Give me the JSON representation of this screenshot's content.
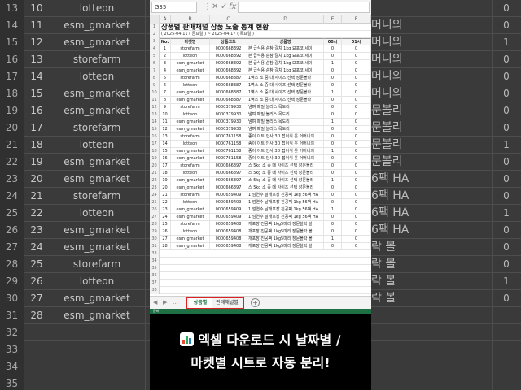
{
  "background": {
    "left_rows": [
      {
        "n": "13",
        "no": "10",
        "ch": "lotteon"
      },
      {
        "n": "14",
        "no": "11",
        "ch": "esm_gmarket"
      },
      {
        "n": "15",
        "no": "12",
        "ch": "esm_gmarket"
      },
      {
        "n": "16",
        "no": "13",
        "ch": "storefarm"
      },
      {
        "n": "17",
        "no": "14",
        "ch": "lotteon"
      },
      {
        "n": "18",
        "no": "15",
        "ch": "esm_gmarket"
      },
      {
        "n": "19",
        "no": "16",
        "ch": "esm_gmarket"
      },
      {
        "n": "20",
        "no": "17",
        "ch": "storefarm"
      },
      {
        "n": "21",
        "no": "18",
        "ch": "lotteon"
      },
      {
        "n": "22",
        "no": "19",
        "ch": "esm_gmarket"
      },
      {
        "n": "23",
        "no": "20",
        "ch": "esm_gmarket"
      },
      {
        "n": "24",
        "no": "21",
        "ch": "storefarm"
      },
      {
        "n": "25",
        "no": "22",
        "ch": "lotteon"
      },
      {
        "n": "26",
        "no": "23",
        "ch": "esm_gmarket"
      },
      {
        "n": "27",
        "no": "24",
        "ch": "esm_gmarket"
      },
      {
        "n": "28",
        "no": "25",
        "ch": "storefarm"
      },
      {
        "n": "29",
        "no": "26",
        "ch": "lotteon"
      },
      {
        "n": "30",
        "no": "27",
        "ch": "esm_gmarket"
      },
      {
        "n": "31",
        "no": "28",
        "ch": "esm_gmarket"
      },
      {
        "n": "32",
        "no": "",
        "ch": ""
      },
      {
        "n": "33",
        "no": "",
        "ch": ""
      },
      {
        "n": "34",
        "no": "",
        "ch": ""
      },
      {
        "n": "35",
        "no": "",
        "ch": ""
      }
    ],
    "right_rows": [
      {
        "t": "",
        "v": "0"
      },
      {
        "t": "머니의",
        "v": "0"
      },
      {
        "t": "머니의",
        "v": "1"
      },
      {
        "t": "머니의",
        "v": "0"
      },
      {
        "t": "머니의",
        "v": "0"
      },
      {
        "t": "머니의",
        "v": "0"
      },
      {
        "t": "문볼리",
        "v": "0"
      },
      {
        "t": "문볼리",
        "v": "0"
      },
      {
        "t": "문볼리",
        "v": "1"
      },
      {
        "t": "문볼리",
        "v": "0"
      },
      {
        "t": "6팩 HA",
        "v": "0"
      },
      {
        "t": "6팩 HA",
        "v": "0"
      },
      {
        "t": "6팩 HA",
        "v": "1"
      },
      {
        "t": "6팩 HA",
        "v": "0"
      },
      {
        "t": "락 볼",
        "v": "0"
      },
      {
        "t": "락 볼",
        "v": "0"
      },
      {
        "t": "락 볼",
        "v": "1"
      },
      {
        "t": "락 볼",
        "v": "0"
      }
    ]
  },
  "formula_bar": {
    "cell_ref": "G35",
    "cancel": "✕",
    "enter": "✓",
    "fx": "fx"
  },
  "columns": [
    "A",
    "B",
    "C",
    "D",
    "E",
    "F"
  ],
  "sheet": {
    "title": "상품별 판매채널 상품 노출 통계 현황",
    "subtitle": "( 2025-04-11 ( 금요일 ) ~ 2025-04-17 ( 목요일 ) )",
    "headers": [
      "No.",
      "마켓명",
      "상품코드",
      "상품명",
      "00시",
      "01시"
    ],
    "rows": [
      [
        "1",
        "storefarm",
        "0000668392",
        "본 급식용 순참 갈치 1kg 묘포코 세이",
        "0",
        "0"
      ],
      [
        "2",
        "lotteon",
        "0000668392",
        "본 급식용 순참 갈치 1kg 묘포코 세이",
        "0",
        "0"
      ],
      [
        "3",
        "esm_gmarket",
        "0000668392",
        "본 급식용 순참 갈치 1kg 묘포코 세이",
        "1",
        "0"
      ],
      [
        "4",
        "esm_gmarket",
        "0000668392",
        "본 급식용 순참 갈치 1kg 묘포코 세이",
        "0",
        "0"
      ],
      [
        "5",
        "storefarm",
        "0000668387",
        "1벽스 소 중 대 사이즈 선택 장문볼라",
        "0",
        "0"
      ],
      [
        "6",
        "lotteon",
        "0000668387",
        "1벽스 소 중 대 사이즈 선택 장문볼라",
        "0",
        "0"
      ],
      [
        "7",
        "esm_gmarket",
        "0000668387",
        "1벽스 소 중 대 사이즈 선택 장문볼라",
        "1",
        "0"
      ],
      [
        "8",
        "esm_gmarket",
        "0000668387",
        "1벽스 소 중 대 사이즈 선택 장문볼라",
        "0",
        "0"
      ],
      [
        "9",
        "storefarm",
        "0000379930",
        "냄며 패밀 볼리스 목도리",
        "0",
        "0"
      ],
      [
        "10",
        "lotteon",
        "0000379930",
        "냄며 패밀 볼리스 목도리",
        "0",
        "0"
      ],
      [
        "11",
        "esm_gmarket",
        "0000379930",
        "냄며 패밀 볼리스 목도리",
        "1",
        "0"
      ],
      [
        "12",
        "esm_gmarket",
        "0000379930",
        "냄며 패밀 볼리스 목도리",
        "0",
        "0"
      ],
      [
        "13",
        "storefarm",
        "0000761158",
        "종이 이트 인사 3D 접이식 옷 어머니의",
        "0",
        "0"
      ],
      [
        "14",
        "lotteon",
        "0000761158",
        "종이 이트 인사 3D 접이식 옷 어머니의",
        "0",
        "0"
      ],
      [
        "15",
        "esm_gmarket",
        "0000761158",
        "종이 이트 인사 3D 접이식 옷 어머니의",
        "1",
        "0"
      ],
      [
        "16",
        "esm_gmarket",
        "0000761158",
        "종이 이트 인사 3D 접이식 옷 어머니의",
        "0",
        "0"
      ],
      [
        "17",
        "storefarm",
        "0000666397",
        "스 5kg 소 중 대 사이즈 선택 장문볼라",
        "0",
        "0"
      ],
      [
        "18",
        "lotteon",
        "0000666397",
        "스 5kg 소 중 대 사이즈 선택 장문볼라",
        "0",
        "0"
      ],
      [
        "19",
        "esm_gmarket",
        "0000666397",
        "스 5kg 소 중 대 사이즈 선택 장문볼라",
        "1",
        "0"
      ],
      [
        "20",
        "esm_gmarket",
        "0000666397",
        "스 5kg 소 중 대 사이즈 선택 장문볼라",
        "0",
        "0"
      ],
      [
        "21",
        "storefarm",
        "0000659409",
        "1 엄연수 날개포장 진공팩 1kg 56팩 HA",
        "0",
        "0"
      ],
      [
        "22",
        "lotteon",
        "0000659409",
        "1 엄연수 날개포장 진공팩 1kg 56팩 HA",
        "0",
        "0"
      ],
      [
        "23",
        "esm_gmarket",
        "0000659409",
        "1 엄연수 날개포장 진공팩 1kg 56팩 HA",
        "1",
        "0"
      ],
      [
        "24",
        "esm_gmarket",
        "0000659409",
        "1 엄연수 날개포장 진공팩 1kg 56팩 HA",
        "0",
        "0"
      ],
      [
        "25",
        "storefarm",
        "0000659408",
        "개포장 진공팩 1kg5마리 장문볼락 볼",
        "0",
        "0"
      ],
      [
        "26",
        "lotteon",
        "0000659408",
        "개포장 진공팩 1kg5마리 장문볼락 볼",
        "0",
        "0"
      ],
      [
        "27",
        "esm_gmarket",
        "0000659408",
        "개포장 진공팩 1kg5마리 장문볼락 볼",
        "1",
        "0"
      ],
      [
        "28",
        "esm_gmarket",
        "0000659408",
        "개포장 진공팩 1kg5마리 장문볼락 볼",
        "0",
        "0"
      ]
    ],
    "empty_row_numbers": [
      "33",
      "34",
      "35",
      "36",
      "37",
      "38"
    ]
  },
  "sheet_tabs": {
    "active": "상품별",
    "other": "판매채널별",
    "add": "+"
  },
  "status": {
    "text": "준비"
  },
  "caption": {
    "emoji_name": "bar-chart-emoji",
    "line1": "엑셀 다운로드 시 날짜별 /",
    "line2": "마켓별 시트로 자동 분리!"
  },
  "colors": {
    "excel_green": "#1e7145",
    "highlight_red": "#e02020"
  }
}
